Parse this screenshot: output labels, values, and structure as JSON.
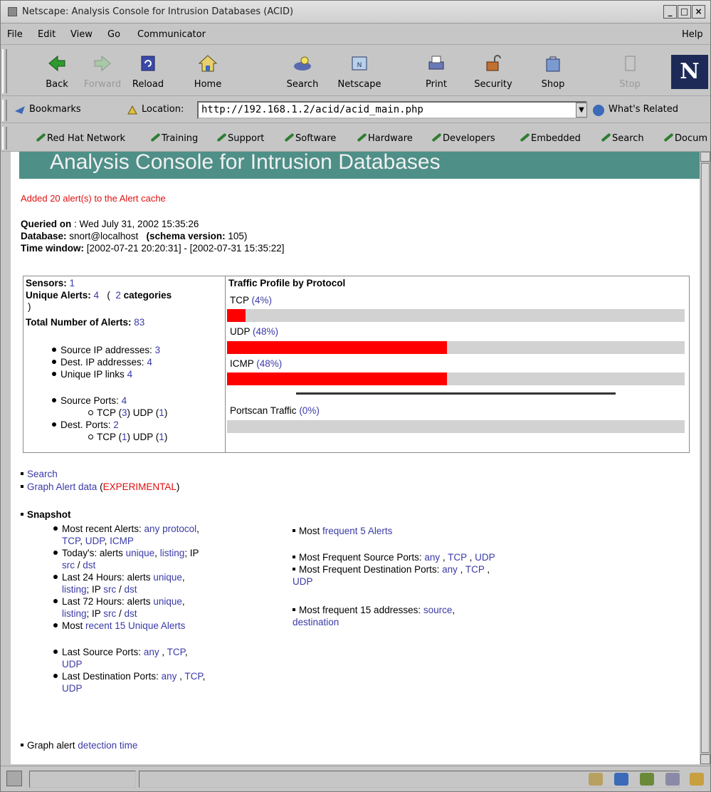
{
  "window": {
    "title": "Netscape: Analysis Console for Intrusion Databases (ACID)"
  },
  "menu": {
    "items": [
      "File",
      "Edit",
      "View",
      "Go",
      "Communicator"
    ],
    "help": "Help"
  },
  "toolbar": {
    "buttons": [
      {
        "label": "Back",
        "icon": "back-arrow-icon"
      },
      {
        "label": "Forward",
        "icon": "forward-arrow-icon"
      },
      {
        "label": "Reload",
        "icon": "reload-icon"
      },
      {
        "label": "Home",
        "icon": "home-icon"
      },
      {
        "label": "Search",
        "icon": "search-icon"
      },
      {
        "label": "Netscape",
        "icon": "netscape-icon"
      },
      {
        "label": "Print",
        "icon": "print-icon"
      },
      {
        "label": "Security",
        "icon": "lock-icon"
      },
      {
        "label": "Shop",
        "icon": "shop-icon"
      },
      {
        "label": "Stop",
        "icon": "stop-icon"
      }
    ],
    "logo": "N"
  },
  "location": {
    "bookmarks_label": "Bookmarks",
    "location_label": "Location:",
    "url": "http://192.168.1.2/acid/acid_main.php",
    "whats_related": "What's Related"
  },
  "personal_toolbar": {
    "items": [
      "Red Hat Network",
      "Training",
      "Support",
      "Software",
      "Hardware",
      "Developers",
      "Embedded",
      "Search",
      "Docum"
    ]
  },
  "page": {
    "banner": "Analysis Console for Intrusion Databases",
    "cache_msg": "Added 20 alert(s) to the Alert cache",
    "queried_label": "Queried on",
    "queried_value": " : Wed July 31, 2002 15:35:26",
    "database_label": "Database:",
    "database_value": " snort@localhost ",
    "schema_label": "(schema version:",
    "schema_value": " 105)",
    "window_label": "Time window:",
    "window_value": " [2002-07-21 20:20:31] - [2002-07-31 15:35:22]",
    "stats": {
      "sensors_label": "Sensors:",
      "sensors_value": "1",
      "unique_label": "Unique Alerts:",
      "unique_value": "4",
      "paren_open": "(",
      "categories_value": "2",
      "categories_label": "categories",
      "paren_close": ")",
      "total_label": "Total Number of Alerts:",
      "total_value": "83",
      "src_ip_label": "Source IP addresses:",
      "src_ip_value": "3",
      "dst_ip_label": "Dest. IP addresses:",
      "dst_ip_value": "4",
      "links_label": "Unique IP links",
      "links_value": "4",
      "src_ports_label": "Source Ports:",
      "src_ports_value": "4",
      "src_tcp_label": "TCP (",
      "src_tcp_value": "3",
      "src_udp_label": ")  UDP (",
      "src_udp_value": "1",
      "close": ")",
      "dst_ports_label": "Dest. Ports:",
      "dst_ports_value": "2",
      "dst_tcp_label": "TCP (",
      "dst_tcp_value": "1",
      "dst_udp_label": ")  UDP (",
      "dst_udp_value": "1"
    },
    "traffic": {
      "title": "Traffic Profile by Protocol",
      "protocols": [
        {
          "name": "TCP",
          "pct_text": "(4%)",
          "value": 4
        },
        {
          "name": "UDP",
          "pct_text": "(48%)",
          "value": 48
        },
        {
          "name": "ICMP",
          "pct_text": "(48%)",
          "value": 48
        }
      ],
      "portscan": {
        "name": "Portscan Traffic",
        "pct_text": "(0%)",
        "value": 0
      }
    },
    "links": {
      "search": "Search",
      "graph_alert": "Graph Alert data",
      "paren_open": " (",
      "experimental": "EXPERIMENTAL",
      "paren_close": ")"
    },
    "snapshot": {
      "title": "Snapshot",
      "recent_prefix": "Most recent Alerts: ",
      "recent_any": "any protocol",
      "comma": ",",
      "tcp": "TCP",
      "udp": "UDP",
      "icmp": "ICMP",
      "today_prefix": "Today's: alerts ",
      "unique": "unique",
      "listing": "listing",
      "ip_text": "; IP",
      "src": "src",
      "slash": " / ",
      "dst": "dst",
      "last24_prefix": "Last 24 Hours: alerts ",
      "last72_prefix": "Last 72 Hours: alerts ",
      "ip_short": "; IP ",
      "most_prefix": "Most ",
      "recent15": "recent 15 Unique Alerts",
      "last_src_ports": "Last Source Ports: ",
      "any": "any",
      "sep": " , ",
      "last_dst_ports": "Last Destination Ports: ",
      "freq5_prefix": "Most ",
      "freq5": "frequent 5 Alerts",
      "freq_src_ports": "Most Frequent Source Ports: ",
      "freq_dst_ports": "Most Frequent Destination Ports: ",
      "freq15": "Most frequent 15 addresses: ",
      "source": "source",
      "destination": "destination"
    },
    "graph_detect_prefix": "Graph alert ",
    "graph_detect_link": "detection time"
  }
}
